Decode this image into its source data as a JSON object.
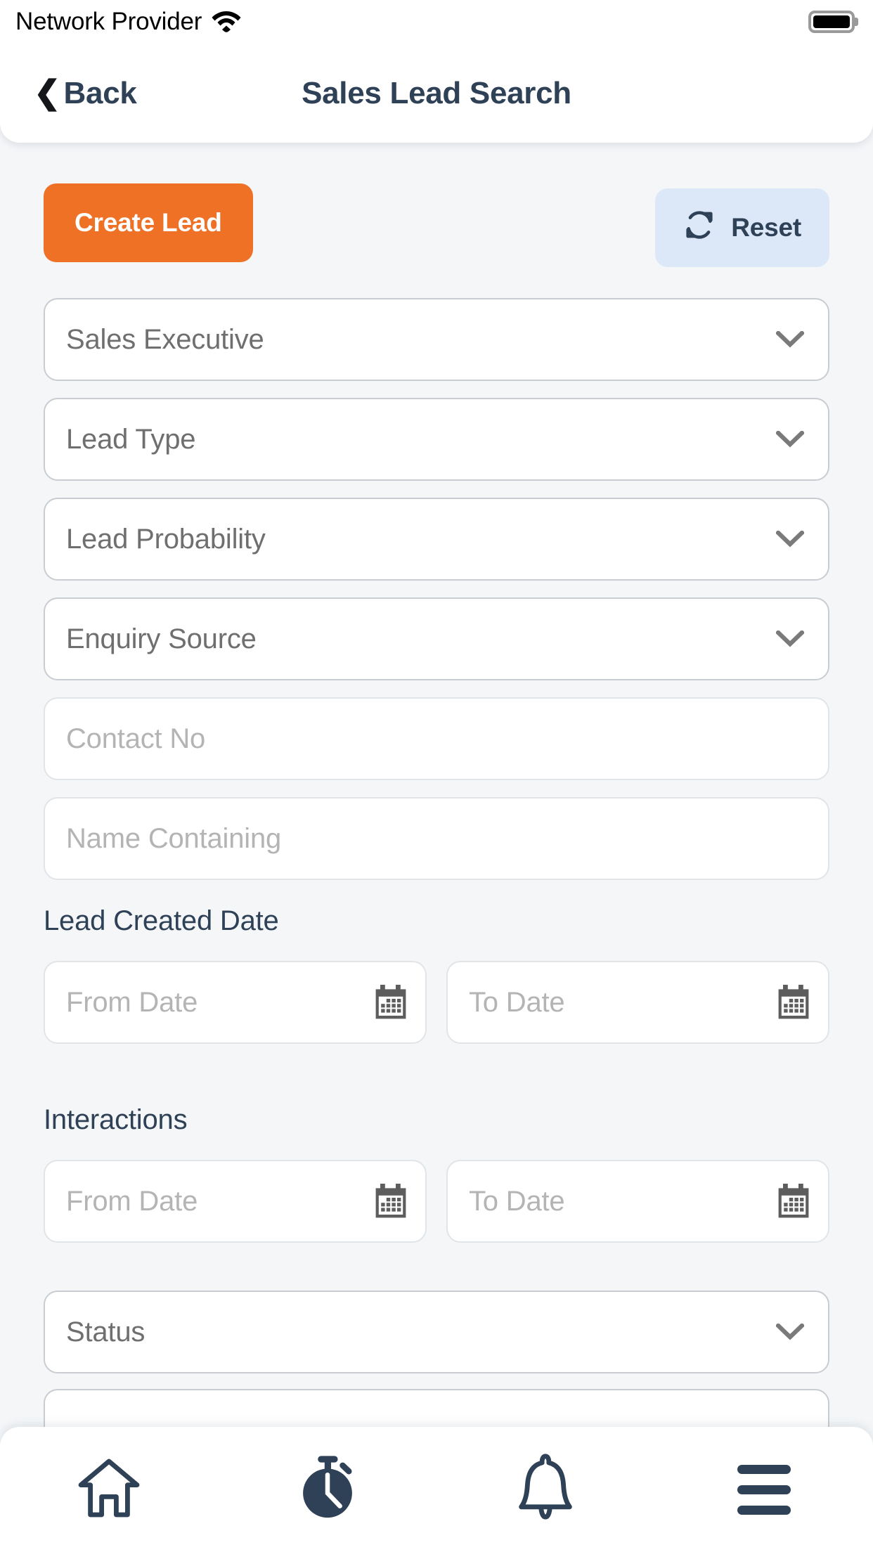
{
  "statusbar": {
    "carrier": "Network Provider",
    "wifi_icon": "wifi-icon",
    "battery_icon": "battery-full-icon"
  },
  "header": {
    "back_label": "Back",
    "back_icon": "chevron-left-icon",
    "title": "Sales Lead Search"
  },
  "toolbar": {
    "create_label": "Create Lead",
    "reset_label": "Reset",
    "reset_icon": "refresh-icon"
  },
  "filters": [
    {
      "label": "Sales Executive",
      "type": "dropdown",
      "icon": "chevron-down-icon"
    },
    {
      "label": "Lead Type",
      "type": "dropdown",
      "icon": "chevron-down-icon"
    },
    {
      "label": "Lead Probability",
      "type": "dropdown",
      "icon": "chevron-down-icon"
    },
    {
      "label": "Enquiry Source",
      "type": "dropdown",
      "icon": "chevron-down-icon"
    },
    {
      "label": "Contact No",
      "type": "text"
    },
    {
      "label": "Name Containing",
      "type": "text"
    }
  ],
  "lead_created_date": {
    "title": "Lead Created Date",
    "from_label": "From Date",
    "to_label": "To Date",
    "icon": "calendar-icon"
  },
  "interactions": {
    "title": "Interactions",
    "from_label": "From Date",
    "to_label": "To Date",
    "icon": "calendar-icon"
  },
  "status_field": {
    "label": "Status",
    "icon": "chevron-down-icon"
  },
  "bottomnav": {
    "items": [
      {
        "name": "home",
        "icon": "home-icon",
        "active": false
      },
      {
        "name": "activity",
        "icon": "stopwatch-icon",
        "active": true
      },
      {
        "name": "notifications",
        "icon": "bell-icon",
        "active": false
      },
      {
        "name": "menu",
        "icon": "hamburger-icon",
        "active": false
      }
    ]
  },
  "colors": {
    "accent_orange": "#EE7125",
    "navy": "#2F4156",
    "reset_bg": "#DCE8F7",
    "page_bg": "#F4F6F8",
    "placeholder": "#B4B4B4",
    "field_text": "#6F6F6F"
  }
}
